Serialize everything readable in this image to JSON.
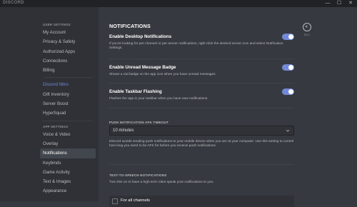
{
  "window": {
    "title": "DISCORD",
    "minimize": "—",
    "maximize": "☐",
    "close": "✕"
  },
  "sidebar": {
    "user_settings_header": "USER SETTINGS",
    "user_items": [
      "My Account",
      "Privacy & Safety",
      "Authorized Apps",
      "Connections",
      "Billing"
    ],
    "nitro_items": [
      "Discord Nitro",
      "Gift Inventory",
      "Server Boost",
      "HypeSquad"
    ],
    "app_settings_header": "APP SETTINGS",
    "app_items": [
      "Voice & Video",
      "Overlay",
      "Notifications",
      "Keybinds",
      "Game Activity",
      "Text & Images",
      "Appearance"
    ],
    "active_item": "Notifications"
  },
  "main": {
    "title": "NOTIFICATIONS",
    "settings": [
      {
        "title": "Enable Desktop Notifications",
        "description": "If you're looking for per-channel or per-server notifications, right-click the desired server icon and select Notification Settings.",
        "enabled": true
      },
      {
        "title": "Enable Unread Message Badge",
        "description": "Shows a red badge on the app icon when you have unread messages.",
        "enabled": true
      },
      {
        "title": "Enable Taskbar Flashing",
        "description": "Flashes the app in your taskbar when you have new notifications.",
        "enabled": true
      }
    ],
    "afk": {
      "label": "PUSH NOTIFICATION AFK TIMEOUT",
      "value": "10 minutes",
      "description": "Discord avoids sending push notifications to your mobile device when you are at your computer. Use this setting to control how long you need to be AFK for before you receive push notifications."
    },
    "tts": {
      "label": "TEXT-TO-SPEECH NOTIFICATIONS",
      "description": "Turn this on to have a high tech robot speak your notifications to you.",
      "option": "For all channels"
    },
    "esc_label": "ESC",
    "colors": {
      "accent": "#7289da",
      "background": "#36393f",
      "sidebar": "#2f3136"
    }
  }
}
